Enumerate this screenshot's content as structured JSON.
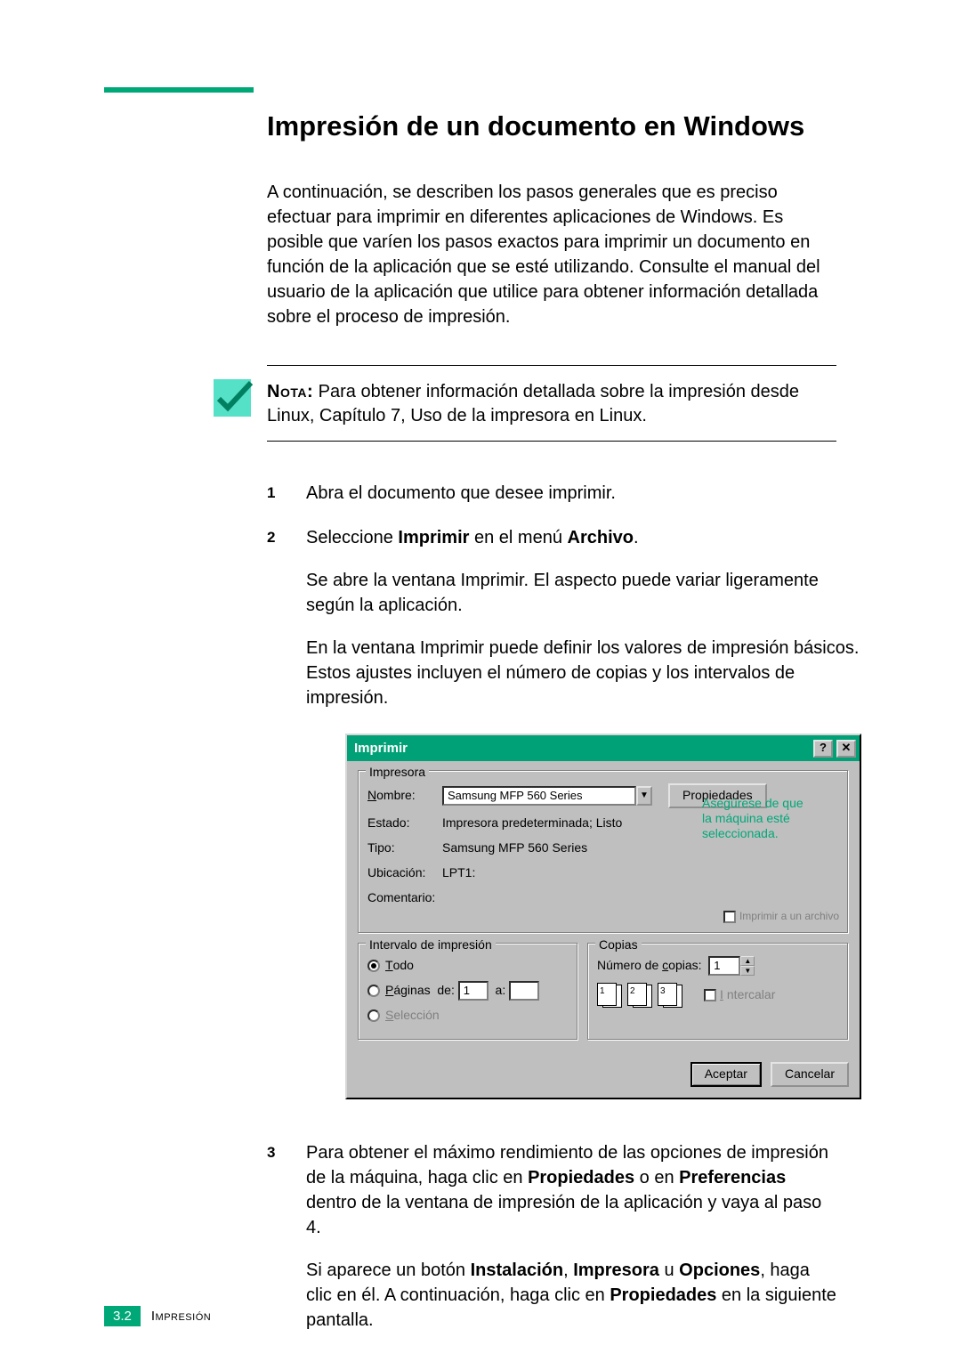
{
  "page": {
    "number": "3.2",
    "section": "Impresión"
  },
  "title": "Impresión de un documento en Windows",
  "intro": "A continuación, se describen los pasos generales que es preciso efectuar para imprimir en diferentes aplicaciones de Windows. Es posible que varíen los pasos exactos para imprimir un documento en función de la aplicación que se esté utilizando. Consulte el manual del usuario de la aplicación que utilice para obtener información detallada sobre el proceso de impresión.",
  "note": {
    "label": "Nota:",
    "text": " Para obtener información detallada sobre la impresión desde Linux, Capítulo 7, Uso de la impresora en Linux."
  },
  "steps": {
    "s1": {
      "num": "1",
      "text": "Abra el documento que desee imprimir."
    },
    "s2": {
      "num": "2",
      "line_a": "Seleccione ",
      "line_b": "Imprimir",
      "line_c": " en el menú ",
      "line_d": "Archivo",
      "line_e": ".",
      "p1": "Se abre la ventana Imprimir. El aspecto puede variar ligeramente según la aplicación.",
      "p2": "En la ventana Imprimir puede definir los valores de impresión básicos. Estos ajustes incluyen el número de copias y los intervalos de impresión."
    },
    "s3": {
      "num": "3",
      "a": "Para obtener el máximo rendimiento de las opciones de impresión de la máquina, haga clic en ",
      "b": "Propiedades",
      "c": " o en ",
      "d": "Preferencias",
      "e": " dentro de la ventana de impresión de la aplicación y vaya al paso 4.",
      "p2a": "Si aparece un botón ",
      "p2b": "Instalación",
      "p2c": ", ",
      "p2d": "Impresora",
      "p2e": " u ",
      "p2f": "Opciones",
      "p2g": ", haga clic en él. A continuación, haga clic en ",
      "p2h": "Propiedades",
      "p2i": " en la siguiente pantalla."
    }
  },
  "dlg": {
    "title": "Imprimir",
    "help_glyph": "?",
    "close_glyph": "✕",
    "grp_printer": "Impresora",
    "lbl_name": "Nombre:",
    "val_name": "Samsung MFP 560 Series",
    "btn_props": "Propiedades",
    "lbl_state": "Estado:",
    "val_state": "Impresora predeterminada; Listo",
    "lbl_type": "Tipo:",
    "val_type": "Samsung MFP 560 Series",
    "lbl_loc": "Ubicación:",
    "val_loc": "LPT1:",
    "lbl_comment": "Comentario:",
    "val_comment": "",
    "print_to_file": "Imprimir a un archivo",
    "callout_l1": "Asegúrese de que",
    "callout_l2": "la máquina esté",
    "callout_l3": "seleccionada.",
    "grp_range": "Intervalo de impresión",
    "r_all": "Todo",
    "r_pages": "Páginas",
    "r_from": "de:",
    "r_from_v": "1",
    "r_to": "a:",
    "r_to_v": "",
    "r_sel": "Selección",
    "grp_copies": "Copias",
    "lbl_copies": "Número de copias:",
    "val_copies": "1",
    "chk_collate": "Intercalar",
    "btn_ok": "Aceptar",
    "btn_cancel": "Cancelar"
  }
}
